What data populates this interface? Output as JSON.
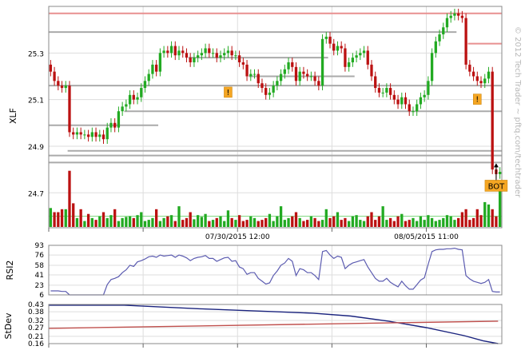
{
  "chart_data": [
    {
      "type": "candlestick",
      "panel": "price",
      "ylabel": "XLF",
      "ylim": [
        24.55,
        25.5
      ],
      "yticks": [
        "25.3",
        "25.1",
        "24.9",
        "24.7"
      ],
      "date_labels": [
        {
          "text": "07/30/2015 12:00",
          "at_bar": 50
        },
        {
          "text": "08/05/2015 11:00",
          "at_bar": 100
        }
      ],
      "colors": {
        "up": "#22aa22",
        "down": "#bb1111",
        "resistance": "#e89090",
        "support": "#aaaaaa",
        "grid": "#dddddd"
      },
      "series": [
        {
          "name": "close",
          "values": [
            25.22,
            25.18,
            25.16,
            25.15,
            25.16,
            24.96,
            24.95,
            24.96,
            24.95,
            24.95,
            24.94,
            24.96,
            24.94,
            24.95,
            24.93,
            24.98,
            25.0,
            24.98,
            25.05,
            25.07,
            25.08,
            25.12,
            25.1,
            25.11,
            25.15,
            25.18,
            25.21,
            25.25,
            25.22,
            25.3,
            25.31,
            25.3,
            25.33,
            25.29,
            25.31,
            25.3,
            25.28,
            25.26,
            25.28,
            25.29,
            25.3,
            25.32,
            25.3,
            25.3,
            25.28,
            25.29,
            25.3,
            25.31,
            25.29,
            25.29,
            25.26,
            25.25,
            25.2,
            25.21,
            25.21,
            25.17,
            25.15,
            25.12,
            25.13,
            25.16,
            25.18,
            25.21,
            25.23,
            25.26,
            25.24,
            25.18,
            25.22,
            25.21,
            25.2,
            25.2,
            25.18,
            25.16,
            25.36,
            25.37,
            25.34,
            25.31,
            25.33,
            25.32,
            25.24,
            25.26,
            25.28,
            25.29,
            25.3,
            25.31,
            25.25,
            25.2,
            25.15,
            25.13,
            25.13,
            25.15,
            25.12,
            25.1,
            25.08,
            25.11,
            25.08,
            25.05,
            25.05,
            25.08,
            25.11,
            25.12,
            25.18,
            25.3,
            25.35,
            25.38,
            25.41,
            25.45,
            25.46,
            25.47,
            25.46,
            25.45,
            25.25,
            25.22,
            25.2,
            25.18,
            25.17,
            25.19,
            25.22,
            24.8,
            24.78,
            24.79
          ]
        },
        {
          "name": "volume",
          "values": [
            0.32,
            0.25,
            0.25,
            0.3,
            0.3,
            0.95,
            0.4,
            0.15,
            0.3,
            0.1,
            0.22,
            0.15,
            0.12,
            0.18,
            0.25,
            0.15,
            0.2,
            0.3,
            0.1,
            0.15,
            0.17,
            0.18,
            0.15,
            0.2,
            0.25,
            0.1,
            0.12,
            0.15,
            0.3,
            0.1,
            0.15,
            0.18,
            0.2,
            0.1,
            0.35,
            0.12,
            0.15,
            0.25,
            0.13,
            0.2,
            0.17,
            0.22,
            0.1,
            0.12,
            0.15,
            0.18,
            0.1,
            0.28,
            0.15,
            0.12,
            0.2,
            0.1,
            0.12,
            0.18,
            0.15,
            0.1,
            0.12,
            0.15,
            0.22,
            0.1,
            0.18,
            0.35,
            0.12,
            0.15,
            0.18,
            0.25,
            0.15,
            0.1,
            0.12,
            0.18,
            0.15,
            0.1,
            0.12,
            0.3,
            0.15,
            0.18,
            0.25,
            0.12,
            0.15,
            0.1,
            0.18,
            0.2,
            0.12,
            0.1,
            0.18,
            0.25,
            0.12,
            0.18,
            0.35,
            0.12,
            0.15,
            0.1,
            0.18,
            0.22,
            0.1,
            0.12,
            0.15,
            0.1,
            0.18,
            0.12,
            0.2,
            0.15,
            0.1,
            0.12,
            0.15,
            0.2,
            0.18,
            0.12,
            0.15,
            0.25,
            0.3,
            0.12,
            0.15,
            0.3,
            0.2,
            0.42,
            0.38,
            0.3,
            0.18,
            0.65
          ]
        }
      ],
      "resistance_lines": [
        {
          "level": 25.47,
          "from_bar": 0,
          "to_bar": 119,
          "color": "#e89090"
        },
        {
          "level": 25.39,
          "from_bar": 0,
          "to_bar": 107,
          "color": "#aaaaaa"
        },
        {
          "level": 25.34,
          "from_bar": 111,
          "to_bar": 119,
          "color": "#e89090"
        },
        {
          "level": 25.28,
          "from_bar": 37,
          "to_bar": 73,
          "color": "#aaaaaa"
        },
        {
          "level": 25.2,
          "from_bar": 53,
          "to_bar": 80,
          "color": "#aaaaaa"
        },
        {
          "level": 25.16,
          "from_bar": 0,
          "to_bar": 73,
          "color": "#aaaaaa"
        },
        {
          "level": 25.16,
          "from_bar": 74,
          "to_bar": 119,
          "color": "#aaaaaa"
        },
        {
          "level": 25.05,
          "from_bar": 20,
          "to_bar": 119,
          "color": "#aaaaaa"
        },
        {
          "level": 24.99,
          "from_bar": 0,
          "to_bar": 28,
          "color": "#aaaaaa"
        },
        {
          "level": 24.88,
          "from_bar": 5,
          "to_bar": 119,
          "color": "#aaaaaa"
        },
        {
          "level": 24.86,
          "from_bar": 0,
          "to_bar": 119,
          "color": "#aaaaaa"
        },
        {
          "level": 24.83,
          "from_bar": 0,
          "to_bar": 119,
          "color": "#aaaaaa"
        }
      ],
      "markers": [
        {
          "type": "alert",
          "label": "!",
          "at_bar": 47,
          "price": 25.13
        },
        {
          "type": "alert",
          "label": "!",
          "at_bar": 113,
          "price": 25.1
        },
        {
          "type": "signal",
          "label": "BOT",
          "at_bar": 118,
          "price": 24.72
        }
      ],
      "watermark": "© 2012 Tech Trader ~ pftq.com/techtrader"
    },
    {
      "type": "line",
      "panel": "indicator",
      "ylabel": "RSI2",
      "ylim": [
        6,
        93
      ],
      "yticks": [
        "93",
        "76",
        "58",
        "41",
        "23",
        "6"
      ],
      "series": [
        {
          "name": "rsi2",
          "values": [
            13,
            13,
            13,
            12,
            12,
            6,
            6,
            6,
            6,
            6,
            6,
            6,
            6,
            6,
            6,
            24,
            33,
            35,
            38,
            45,
            50,
            58,
            56,
            64,
            66,
            69,
            73,
            74,
            72,
            76,
            74,
            75,
            76,
            72,
            76,
            74,
            71,
            66,
            70,
            72,
            73,
            75,
            70,
            70,
            65,
            68,
            71,
            72,
            65,
            66,
            55,
            52,
            42,
            45,
            45,
            35,
            30,
            25,
            27,
            40,
            48,
            58,
            62,
            70,
            65,
            40,
            52,
            50,
            45,
            45,
            40,
            33,
            82,
            84,
            76,
            70,
            74,
            72,
            52,
            58,
            62,
            64,
            66,
            68,
            55,
            45,
            35,
            30,
            30,
            35,
            28,
            24,
            20,
            30,
            22,
            16,
            16,
            24,
            32,
            36,
            60,
            82,
            85,
            86,
            86,
            87,
            87,
            88,
            86,
            85,
            40,
            34,
            30,
            28,
            26,
            28,
            33,
            12,
            11,
            11
          ]
        }
      ]
    },
    {
      "type": "line",
      "panel": "indicator",
      "ylabel": "StDev",
      "ylim": [
        0.16,
        0.43
      ],
      "yticks": [
        "0.43",
        "0.38",
        "0.32",
        "0.27",
        "0.21",
        "0.16"
      ],
      "series": [
        {
          "name": "stdev",
          "color": "#1a237e",
          "points": [
            [
              0,
              0.425
            ],
            [
              20,
              0.425
            ],
            [
              40,
              0.4
            ],
            [
              60,
              0.38
            ],
            [
              70,
              0.37
            ],
            [
              80,
              0.35
            ],
            [
              90,
              0.315
            ],
            [
              100,
              0.27
            ],
            [
              110,
              0.215
            ],
            [
              115,
              0.18
            ],
            [
              119,
              0.16
            ]
          ]
        },
        {
          "name": "average",
          "color": "#c0504d",
          "points": [
            [
              0,
              0.265
            ],
            [
              119,
              0.315
            ]
          ]
        }
      ]
    }
  ]
}
